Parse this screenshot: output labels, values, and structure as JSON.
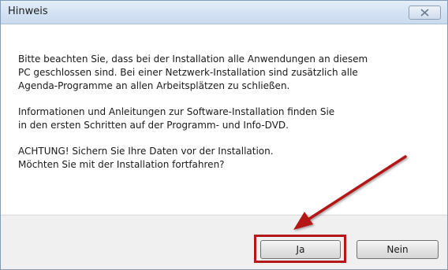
{
  "dialog": {
    "title": "Hinweis",
    "close_icon": "close-icon",
    "paragraphs": [
      {
        "lines": [
          "Bitte beachten Sie, dass bei der Installation alle Anwendungen an diesem",
          "PC geschlossen sind. Bei einer Netzwerk-Installation sind zusätzlich alle",
          "Agenda-Programme an allen Arbeitsplätzen zu schließen."
        ]
      },
      {
        "lines": [
          "Informationen und Anleitungen zur Software-Installation finden Sie",
          "in den ersten Schritten auf der Programm- und Info-DVD."
        ]
      },
      {
        "lines": [
          "ACHTUNG! Sichern Sie Ihre Daten vor der Installation.",
          "Möchten Sie mit der Installation fortfahren?"
        ]
      }
    ],
    "buttons": {
      "yes_label": "Ja",
      "no_label": "Nein"
    }
  },
  "annotation": {
    "highlight_color": "#b41818",
    "arrow_color": "#b41818"
  }
}
